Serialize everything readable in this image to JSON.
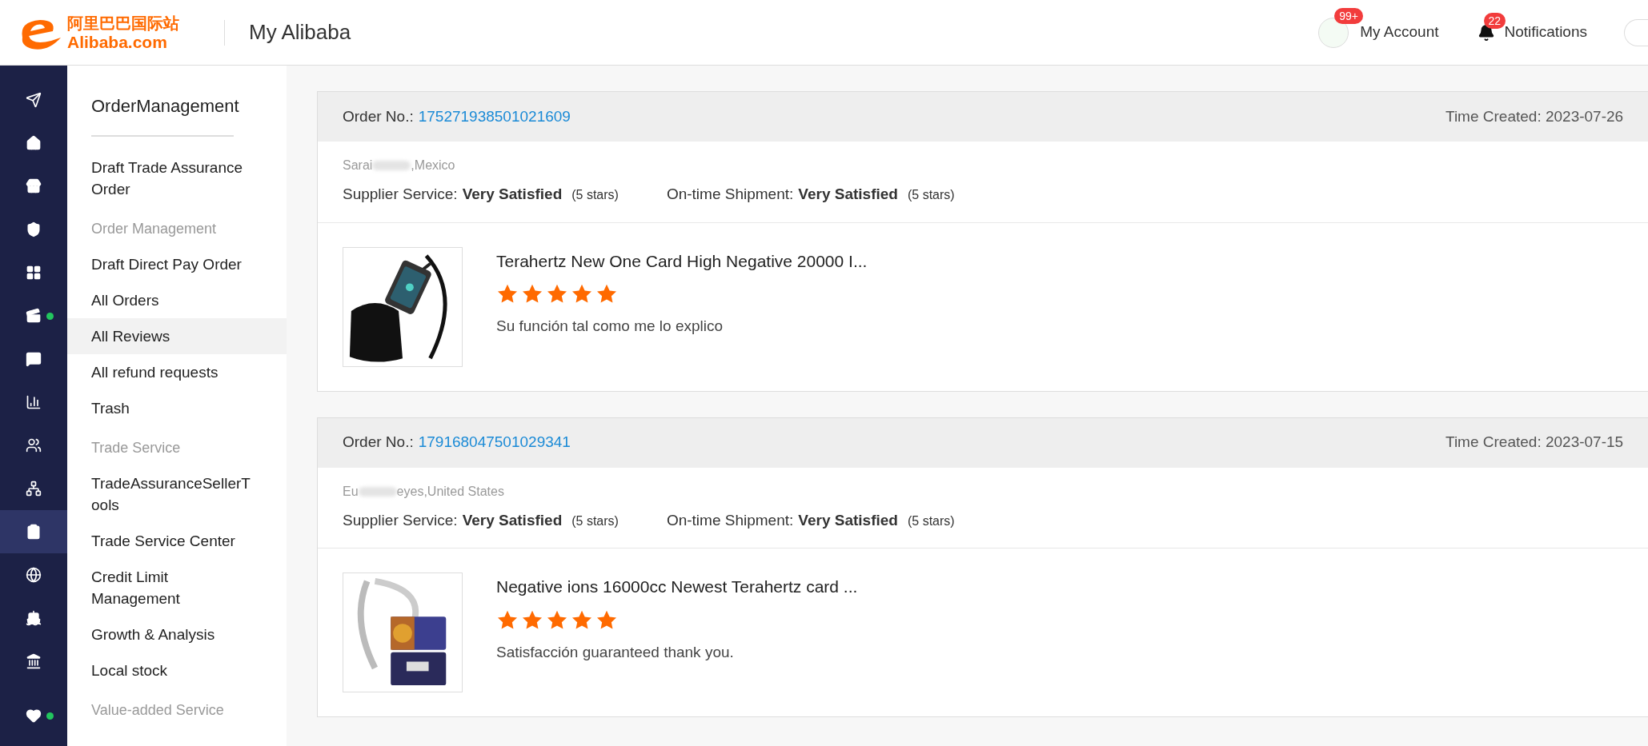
{
  "header": {
    "logo_cn": "阿里巴巴国际站",
    "logo_en": "Alibaba.com",
    "title": "My Alibaba",
    "account": {
      "label": "My Account",
      "badge": "99+"
    },
    "notifications": {
      "label": "Notifications",
      "badge": "22"
    }
  },
  "rail": [
    {
      "kind": "send",
      "selected": false,
      "dot": false
    },
    {
      "kind": "home",
      "selected": false,
      "dot": false
    },
    {
      "kind": "store",
      "selected": false,
      "dot": false
    },
    {
      "kind": "shield",
      "selected": false,
      "dot": false
    },
    {
      "kind": "widgets",
      "selected": false,
      "dot": false
    },
    {
      "kind": "video",
      "selected": false,
      "dot": true
    },
    {
      "kind": "chat",
      "selected": false,
      "dot": false
    },
    {
      "kind": "chart",
      "selected": false,
      "dot": false
    },
    {
      "kind": "users",
      "selected": false,
      "dot": false
    },
    {
      "kind": "network",
      "selected": false,
      "dot": false
    },
    {
      "kind": "clipboard",
      "selected": true,
      "dot": false
    },
    {
      "kind": "globe",
      "selected": false,
      "dot": false
    },
    {
      "kind": "ship",
      "selected": false,
      "dot": false
    },
    {
      "kind": "bank",
      "selected": false,
      "dot": false
    },
    {
      "kind": "heart",
      "selected": false,
      "dot": true
    }
  ],
  "nav": {
    "title": "OrderManagement",
    "sections": [
      {
        "items": [
          {
            "label": "Draft Trade Assurance Order",
            "selected": false
          }
        ]
      },
      {
        "heading": "Order Management",
        "items": [
          {
            "label": "Draft Direct Pay Order",
            "selected": false
          },
          {
            "label": "All Orders",
            "selected": false
          },
          {
            "label": "All Reviews",
            "selected": true
          },
          {
            "label": "All refund requests",
            "selected": false
          },
          {
            "label": "Trash",
            "selected": false
          }
        ]
      },
      {
        "heading": "Trade Service",
        "items": [
          {
            "label": "TradeAssuranceSellerTools",
            "selected": false
          },
          {
            "label": "Trade Service Center",
            "selected": false
          },
          {
            "label": "Credit Limit Management",
            "selected": false
          },
          {
            "label": "Growth & Analysis",
            "selected": false
          },
          {
            "label": "Local stock",
            "selected": false
          }
        ]
      },
      {
        "heading": "Value-added Service"
      }
    ]
  },
  "orders": [
    {
      "order_label": "Order No.:",
      "order_no": "175271938501021609",
      "time_label": "Time Created:",
      "time": "2023-07-26",
      "buyer_start": "Sarai",
      "buyer_end": ",Mexico",
      "supplier_label": "Supplier Service:",
      "supplier_value": "Very Satisfied",
      "supplier_stars": "(5 stars)",
      "shipment_label": "On-time Shipment:",
      "shipment_value": "Very Satisfied",
      "shipment_stars": "(5 stars)",
      "product": "Terahertz New One Card High Negative 20000 I...",
      "stars": 5,
      "review": "Su función tal como me lo explico"
    },
    {
      "order_label": "Order No.:",
      "order_no": "179168047501029341",
      "time_label": "Time Created:",
      "time": "2023-07-15",
      "buyer_start": "Eu",
      "buyer_end": "eyes,United States",
      "supplier_label": "Supplier Service:",
      "supplier_value": "Very Satisfied",
      "supplier_stars": "(5 stars)",
      "shipment_label": "On-time Shipment:",
      "shipment_value": "Very Satisfied",
      "shipment_stars": "(5 stars)",
      "product": "Negative ions 16000cc Newest Terahertz card ...",
      "stars": 5,
      "review": "Satisfacción guaranteed thank you."
    }
  ]
}
